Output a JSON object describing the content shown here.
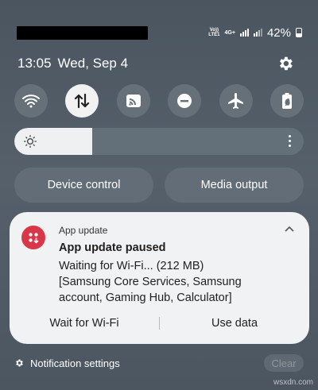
{
  "status_bar": {
    "network_top": "Vo))",
    "network_bottom": "LTE1",
    "network_type": "4G+",
    "battery": "42%"
  },
  "header": {
    "time": "13:05",
    "date": "Wed, Sep 4"
  },
  "quick_tiles": [
    {
      "name": "wifi",
      "icon": "wifi-icon",
      "active": false
    },
    {
      "name": "mobile-data",
      "icon": "mobile-data-icon",
      "active": true
    },
    {
      "name": "cast",
      "icon": "cast-icon",
      "active": false
    },
    {
      "name": "do-not-disturb",
      "icon": "dnd-icon",
      "active": false
    },
    {
      "name": "airplane-mode",
      "icon": "airplane-icon",
      "active": false
    },
    {
      "name": "power-saving",
      "icon": "battery-saver-icon",
      "active": false
    }
  ],
  "brightness": {
    "level": 0.27
  },
  "controls": {
    "device_control": "Device control",
    "media_output": "Media output"
  },
  "notification": {
    "app_name": "App update",
    "title": "App update paused",
    "body_lines": [
      "Waiting for Wi-Fi... (212 MB)",
      "[Samsung Core Services, Samsung",
      "account, Gaming Hub, Calculator]"
    ],
    "action_wait": "Wait for Wi-Fi",
    "action_use_data": "Use data",
    "accent_color": "#d8374a"
  },
  "footer": {
    "notification_settings": "Notification settings",
    "clear": "Clear"
  },
  "watermark": "wsxdn.com"
}
